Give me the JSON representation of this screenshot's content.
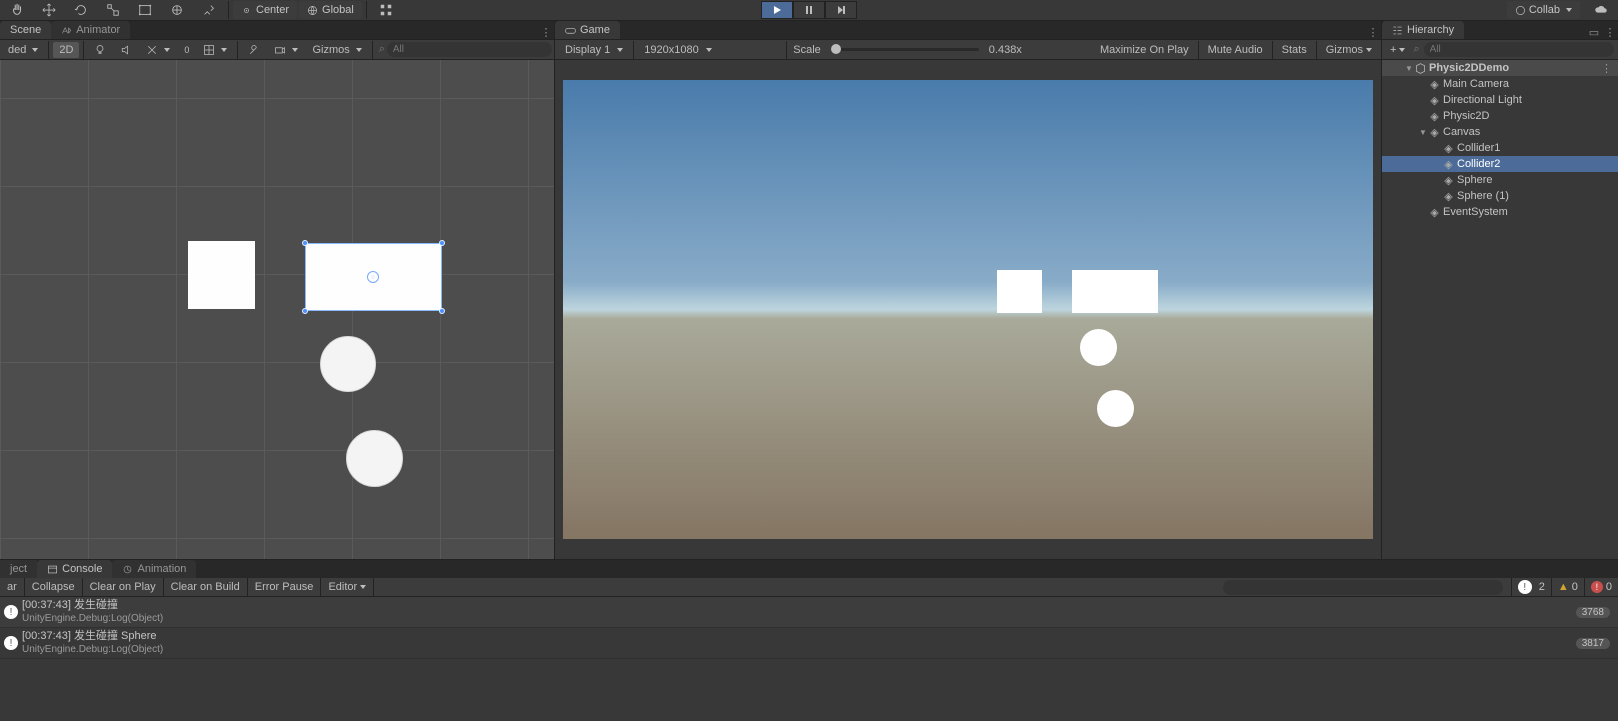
{
  "toolbar": {
    "pivot": "Center",
    "handle": "Global",
    "collab": "Collab"
  },
  "sceneTab": "Scene",
  "animatorTab": "Animator",
  "sceneBar": {
    "shading": "ded",
    "twoD": "2D",
    "gizmos": "Gizmos",
    "searchPlaceholder": "All"
  },
  "gameTab": "Game",
  "gameBar": {
    "display": "Display 1",
    "resolution": "1920x1080",
    "scaleLabel": "Scale",
    "scaleValue": "0.438x",
    "maximize": "Maximize On Play",
    "mute": "Mute Audio",
    "stats": "Stats",
    "gizmos": "Gizmos"
  },
  "hierTab": "Hierarchy",
  "hierSearchPlaceholder": "All",
  "hierarchy": {
    "scene": "Physic2DDemo",
    "items": [
      "Main Camera",
      "Directional Light",
      "Physic2D",
      "Canvas",
      "Collider1",
      "Collider2",
      "Sphere",
      "Sphere (1)",
      "EventSystem"
    ]
  },
  "bottomTabs": {
    "project": "ject",
    "console": "Console",
    "animation": "Animation"
  },
  "consoleBar": {
    "clear": "ar",
    "collapse": "Collapse",
    "clearPlay": "Clear on Play",
    "clearBuild": "Clear on Build",
    "errorPause": "Error Pause",
    "editor": "Editor"
  },
  "counters": {
    "info": "2",
    "warn": "0",
    "error": "0"
  },
  "logs": [
    {
      "time": "[00:37:43]",
      "msg": "发生碰撞",
      "sub": "UnityEngine.Debug:Log(Object)",
      "count": "3768"
    },
    {
      "time": "[00:37:43]",
      "msg": "发生碰撞 Sphere",
      "sub": "UnityEngine.Debug:Log(Object)",
      "count": "3817"
    }
  ]
}
